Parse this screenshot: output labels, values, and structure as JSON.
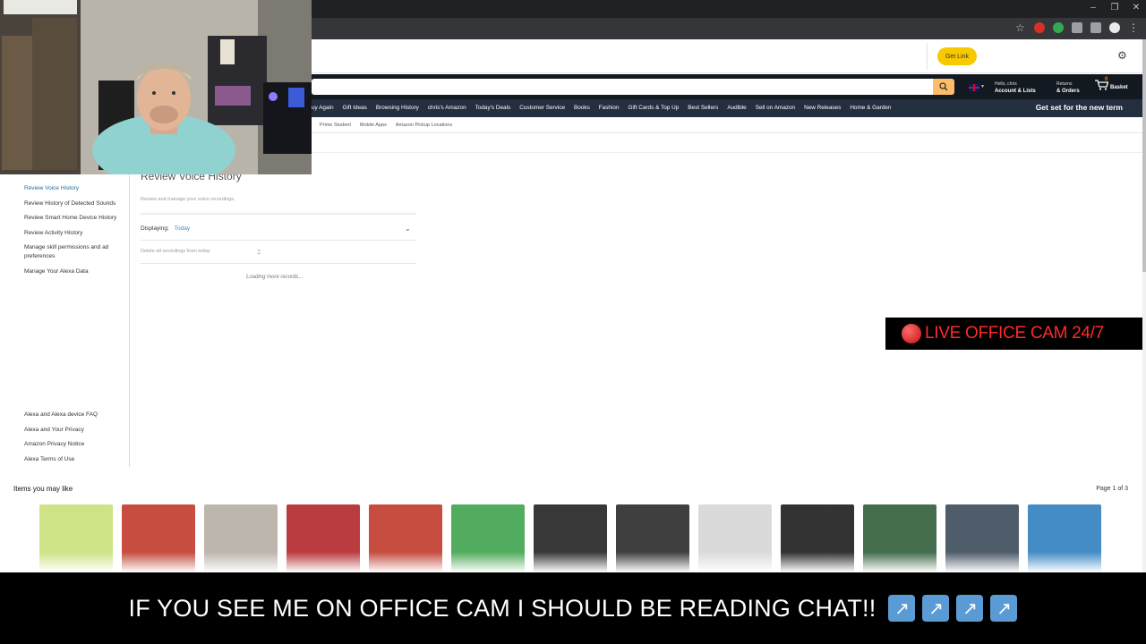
{
  "window": {
    "controls": [
      "–",
      "❐",
      "✕"
    ]
  },
  "top_strip": {
    "get_link_label": "Get Link"
  },
  "nav": {
    "account_line1": "Hello, chris",
    "account_line2": "Account & Lists",
    "returns_line1": "Returns",
    "returns_line2": "& Orders",
    "basket_count": "0",
    "basket_label": "Basket",
    "sub_items": [
      "uy Again",
      "Gift Ideas",
      "Browsing History",
      "chris's Amazon",
      "Today's Deals",
      "Customer Service",
      "Books",
      "Fashion",
      "Gift Cards & Top Up",
      "Best Sellers",
      "Audible",
      "Sell on Amazon",
      "New Releases",
      "Home & Garden"
    ],
    "promo": "Get set for the new term",
    "tertiary_items": [
      "Prime Student",
      "Mobile Apps",
      "Amazon Pickup Locations"
    ]
  },
  "sidebar": {
    "items": [
      "Review Voice History",
      "Review History of Detected Sounds",
      "Review Smart Home Device History",
      "Review Activity History",
      "Manage skill permissions and ad preferences",
      "Manage Your Alexa Data"
    ],
    "footer_links": [
      "Alexa and Alexa device FAQ",
      "Alexa and Your Privacy",
      "Amazon Privacy Notice",
      "Alexa Terms of Use"
    ]
  },
  "main": {
    "title": "Review Voice History",
    "description": "Review and manage your voice recordings.",
    "displaying_label": "Displaying:",
    "displaying_value": "Today",
    "delete_link": "Delete all recordings from today",
    "loading": "Loading more records..."
  },
  "live_banner": {
    "text": "LIVE OFFICE CAM 24/7"
  },
  "items_strip": {
    "title": "Items you may like",
    "page": "Page 1 of 3",
    "products": [
      {
        "name": "razor-blades",
        "color": "#c9e07a"
      },
      {
        "name": "iron-vitamin-gummies",
        "color": "#c0392b"
      },
      {
        "name": "lmnt-packets",
        "color": "#b5aea3"
      },
      {
        "name": "beef-bar",
        "color": "#b3262a"
      },
      {
        "name": "vitamin-b12-gummies",
        "color": "#c0392b"
      },
      {
        "name": "berocca-pack",
        "color": "#3fa34d"
      },
      {
        "name": "huel-bottles",
        "color": "#222222"
      },
      {
        "name": "huel-powder",
        "color": "#2a2a2a"
      },
      {
        "name": "pick-any-8",
        "color": "#d6d6d6"
      },
      {
        "name": "hair-clipper",
        "color": "#1c1c1c"
      },
      {
        "name": "nutrition-geeks",
        "color": "#2f5d3a"
      },
      {
        "name": "massage-gun",
        "color": "#3b4a5a"
      },
      {
        "name": "harrys-razor",
        "color": "#2f7fbf"
      }
    ]
  },
  "overlay": {
    "bottom_text": "IF YOU SEE ME ON OFFICE CAM I SHOULD BE READING CHAT!!",
    "arrow_glyph": "↗"
  }
}
